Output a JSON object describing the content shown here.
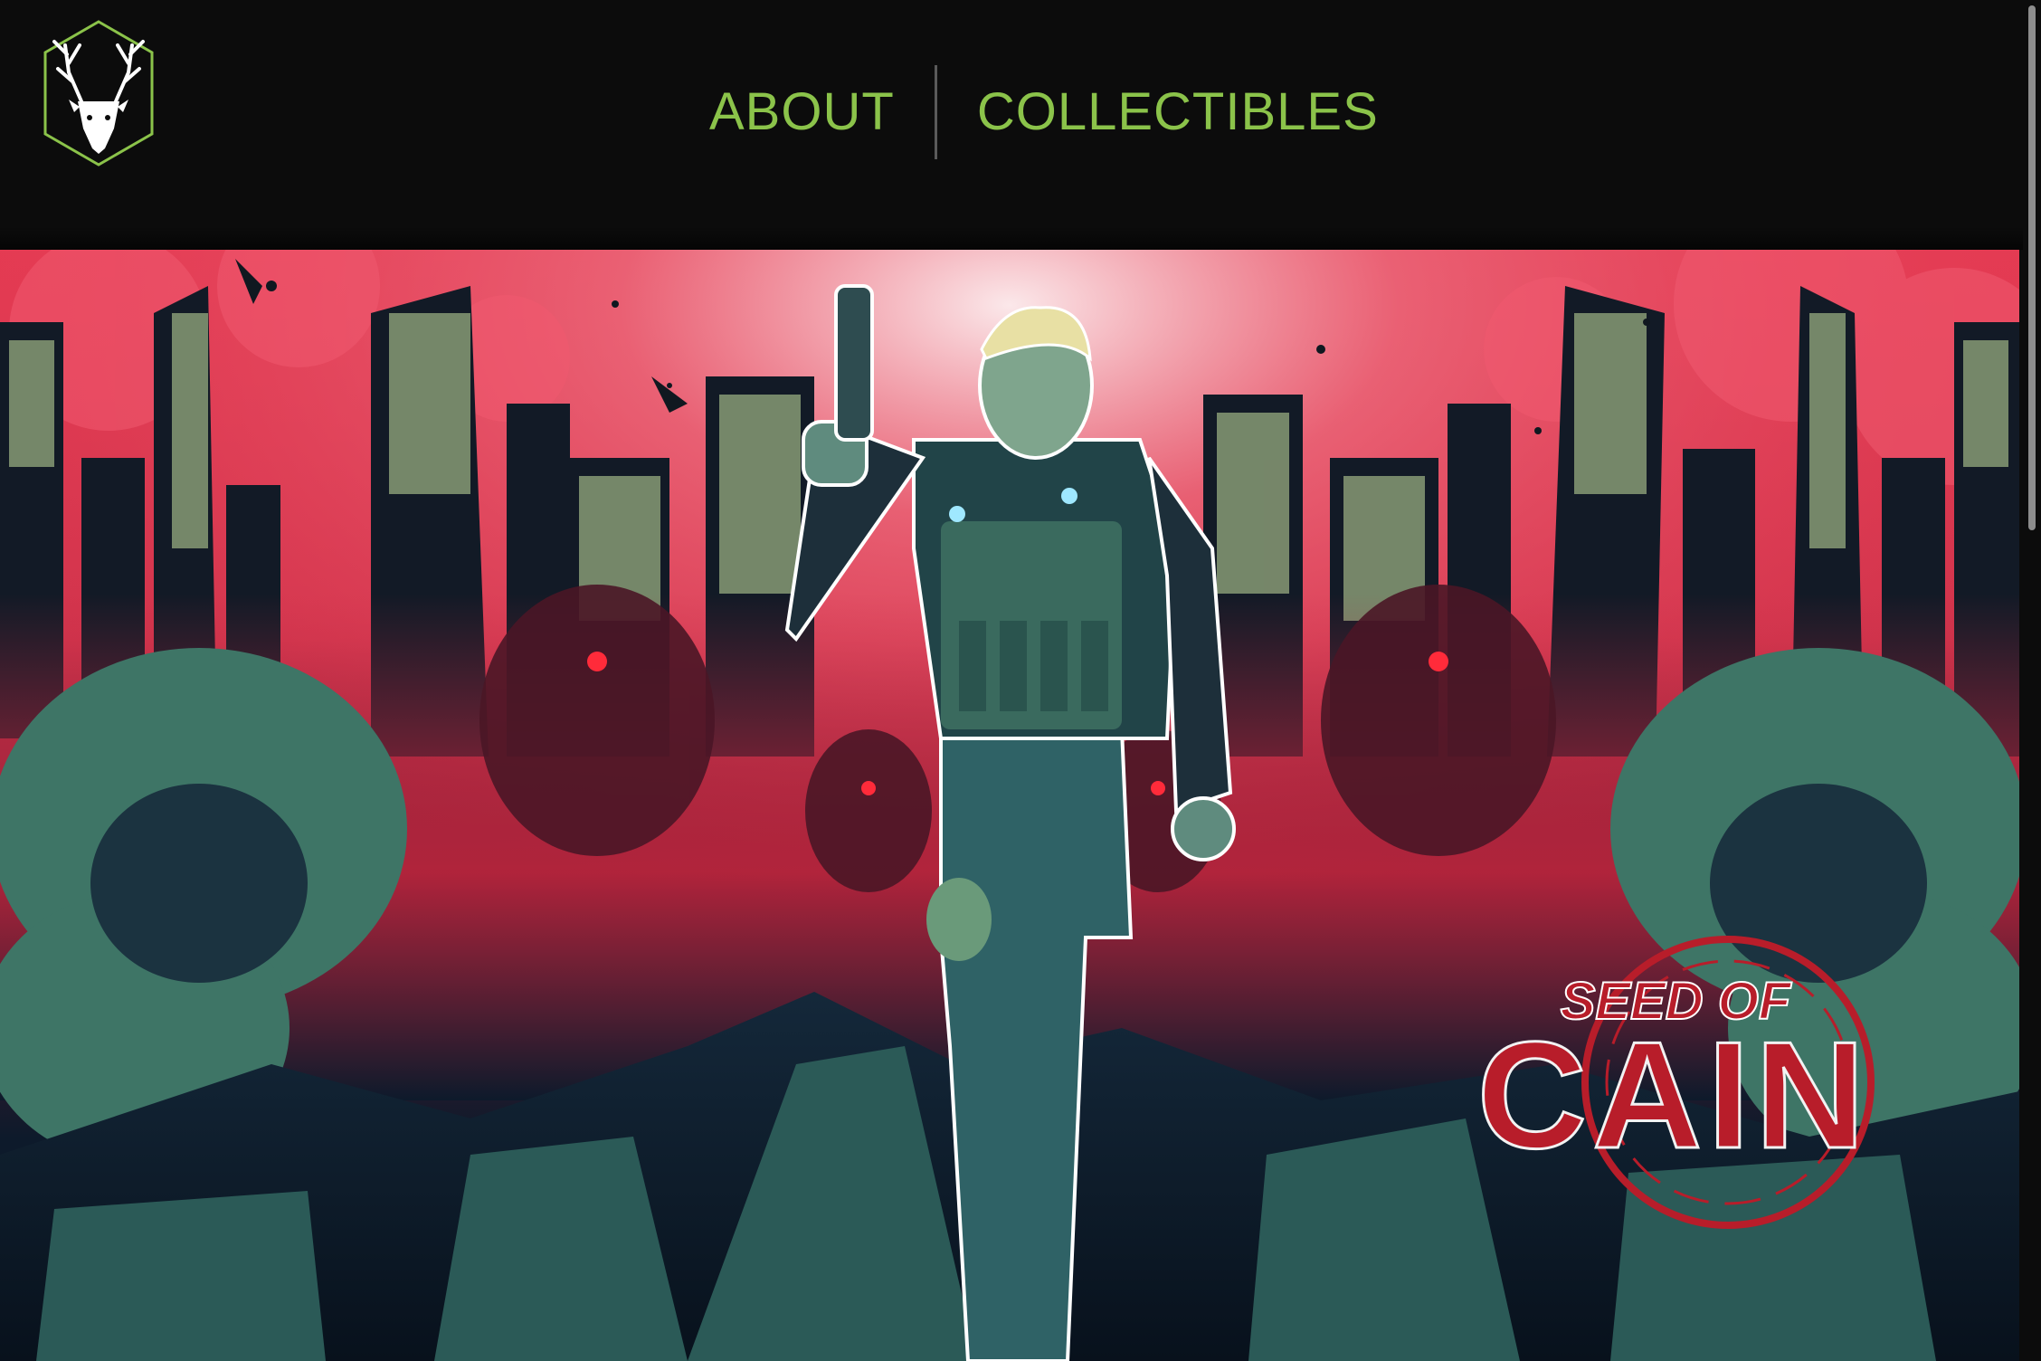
{
  "header": {
    "logo_icon": "stag-head-hexagon-logo",
    "nav": [
      {
        "label": "ABOUT"
      },
      {
        "label": "COLLECTIBLES"
      }
    ],
    "colors": {
      "accent": "#8bc34a",
      "background": "#0c0c0c"
    }
  },
  "hero": {
    "logo_line1": "SEED OF",
    "logo_line2": "CAIN",
    "logo_colors": {
      "red": "#b81d2a",
      "white": "#f2f2f2"
    }
  }
}
